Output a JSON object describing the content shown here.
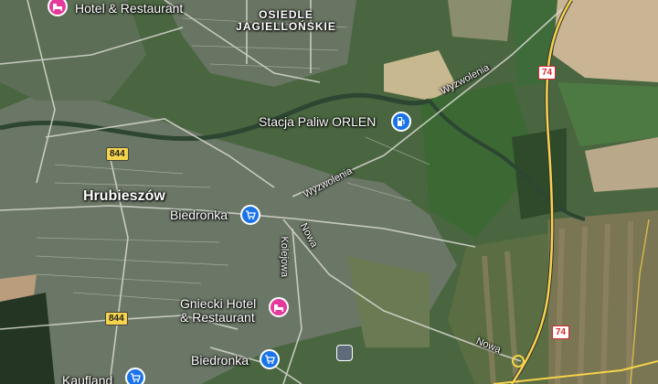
{
  "places": {
    "hotel_top": "Hotel & Restaurant",
    "district": [
      "OSIEDLE",
      "JAGIELLOŃSKIE"
    ],
    "fuel_station": "Stacja Paliw ORLEN",
    "city": "Hrubieszów",
    "biedronka_1": "Biedronka",
    "gniecki": [
      "Gniecki Hotel",
      "& Restaurant"
    ],
    "biedronka_2": "Biedronka",
    "kaufland": "Kaufland"
  },
  "streets": {
    "wyzwolenia_1": "Wyzwolenia",
    "wyzwolenia_2": "Wyzwolenia",
    "nowa_1": "Nowa",
    "nowa_2": "Nowa",
    "kolejowa": "Kolejowa"
  },
  "road_shields": {
    "r844_top": "844",
    "r844_bottom": "844",
    "r74_top": "74",
    "r74_bottom": "74"
  },
  "icons": {
    "hotel": "bed-icon",
    "shop": "shopping-cart-icon",
    "fuel": "fuel-pump-icon",
    "transit": "train-station-icon"
  },
  "colors": {
    "hotel_pin": "#e6399b",
    "shop_pin": "#1a73e8",
    "fuel_pin": "#1a73e8",
    "highway": "#f5d34a"
  }
}
